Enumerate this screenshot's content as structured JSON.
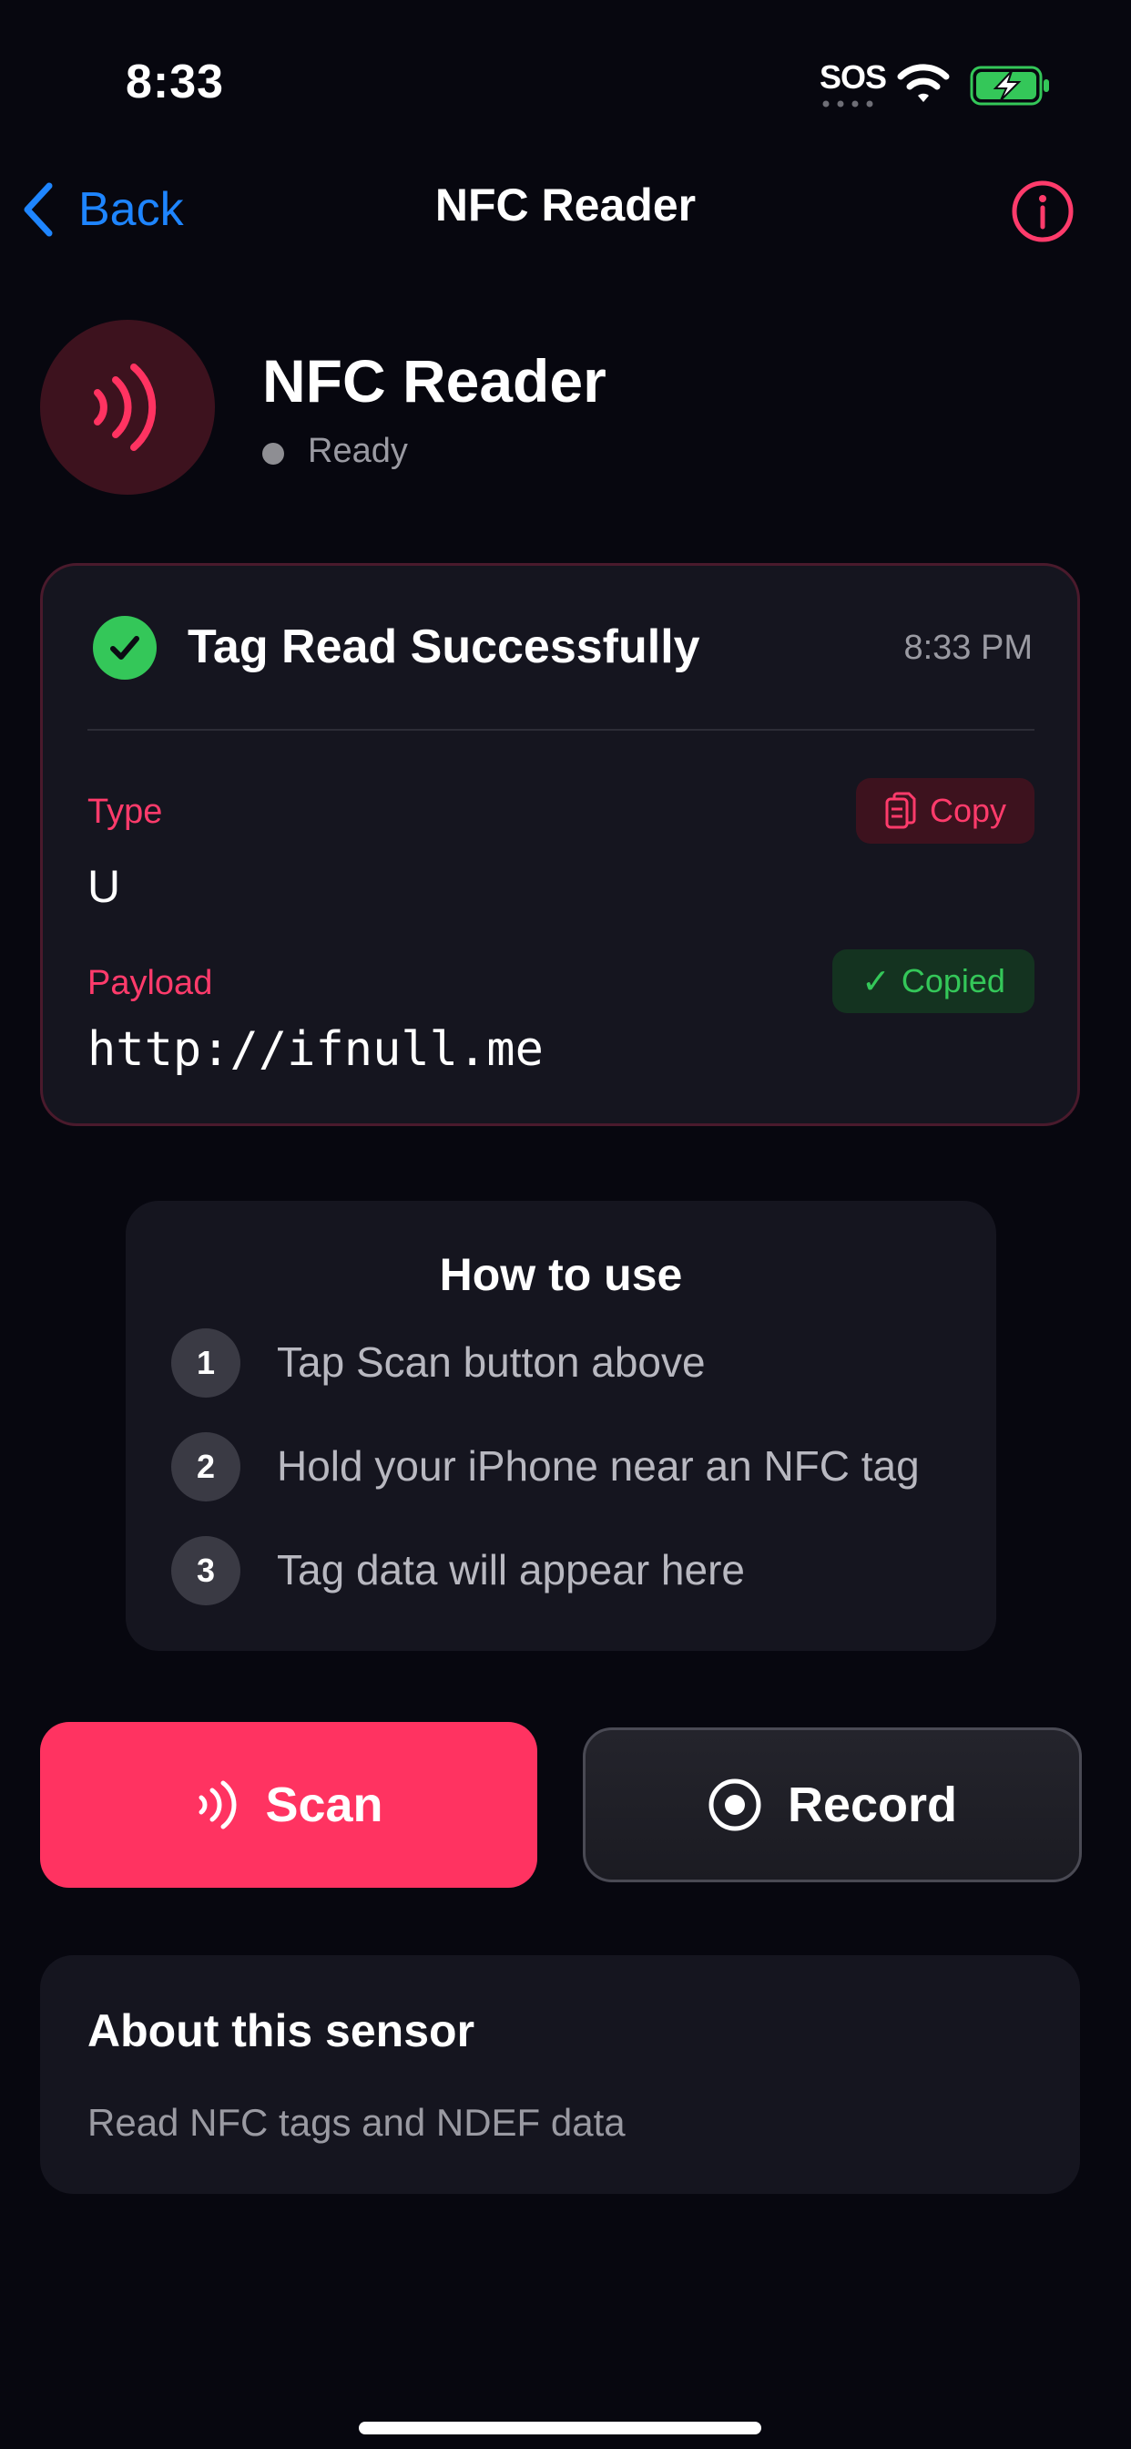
{
  "status_bar": {
    "time": "8:33",
    "sos": "SOS"
  },
  "nav": {
    "back_label": "Back",
    "title": "NFC Reader"
  },
  "header": {
    "title": "NFC Reader",
    "status": "Ready"
  },
  "result": {
    "title": "Tag Read Successfully",
    "time": "8:33 PM",
    "type_label": "Type",
    "type_value": "U",
    "copy_label": "Copy",
    "payload_label": "Payload",
    "copied_label": "Copied",
    "payload_value": "http://ifnull.me"
  },
  "how_to": {
    "title": "How to use",
    "steps": [
      {
        "num": "1",
        "text": "Tap Scan button above"
      },
      {
        "num": "2",
        "text": "Hold your iPhone near an NFC tag"
      },
      {
        "num": "3",
        "text": "Tag data will appear here"
      }
    ]
  },
  "actions": {
    "scan_label": "Scan",
    "record_label": "Record"
  },
  "about": {
    "title": "About this sensor",
    "text": "Read NFC tags and NDEF data"
  },
  "colors": {
    "accent": "#ff3361",
    "link": "#1e85ff",
    "success": "#34c759",
    "background": "#07070f",
    "card": "#15151f"
  }
}
